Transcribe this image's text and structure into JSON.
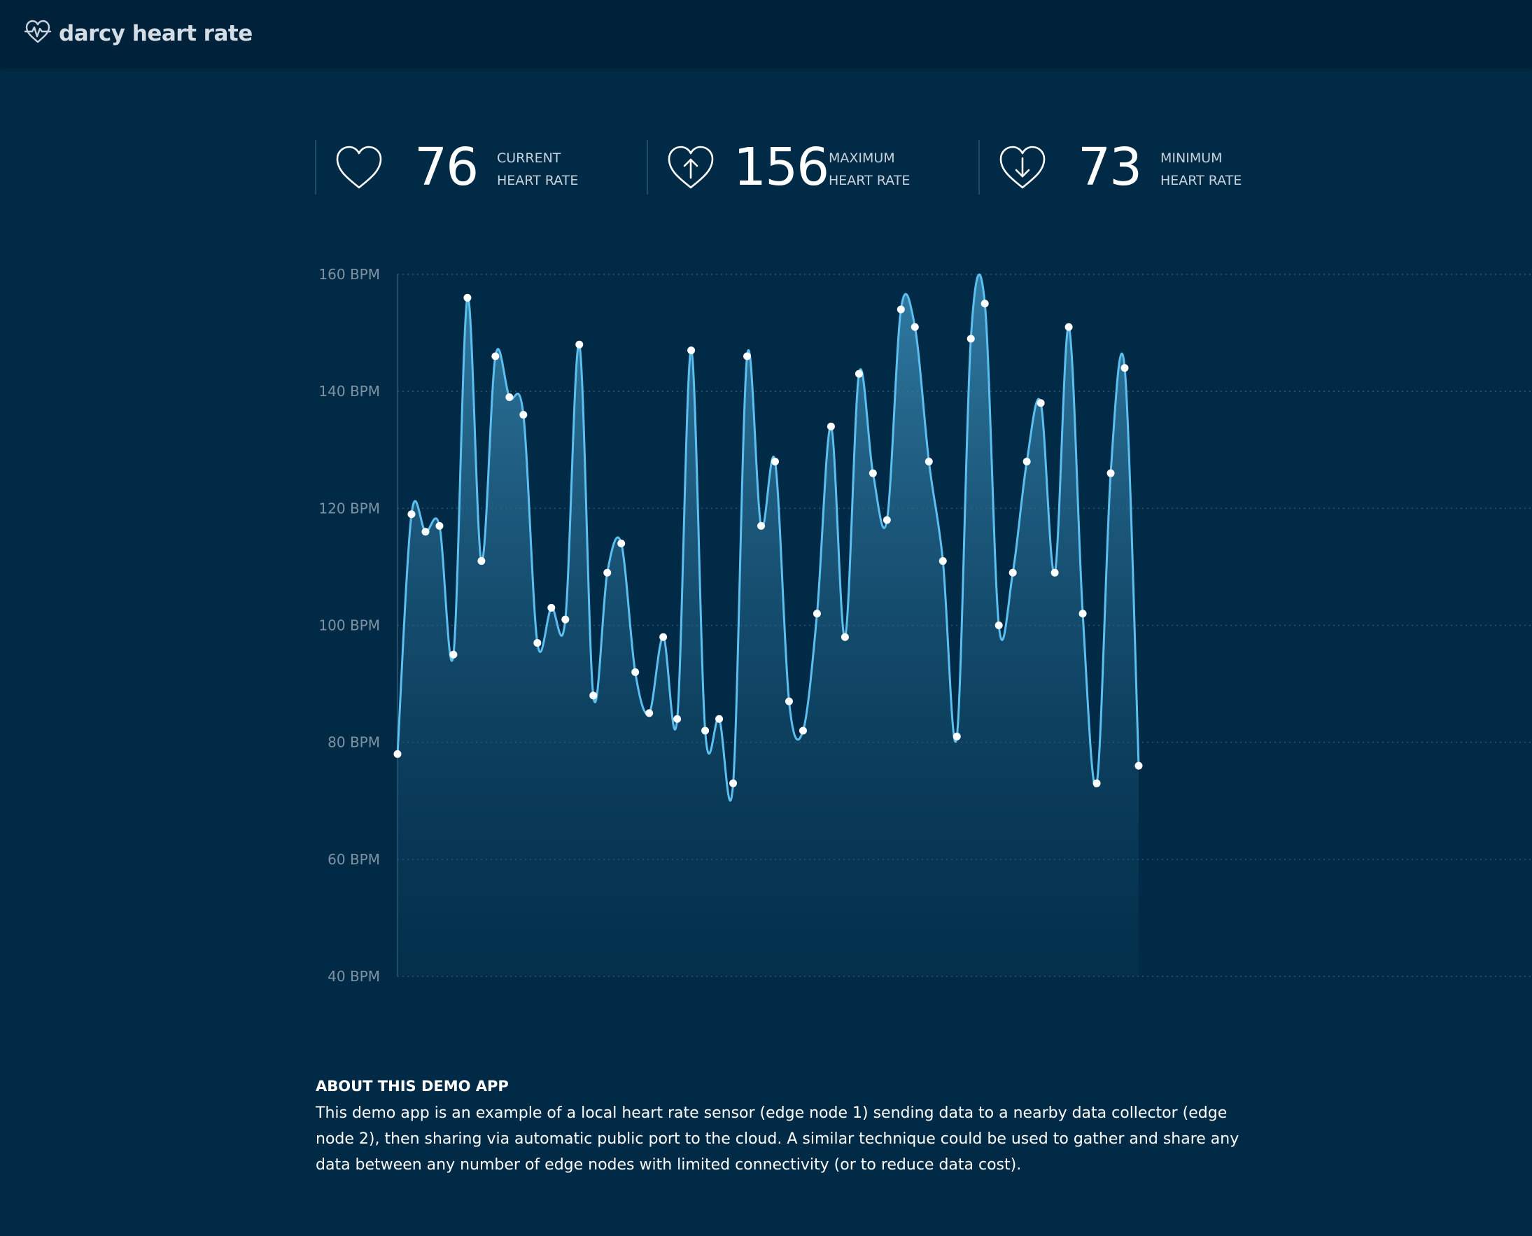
{
  "app": {
    "title": "darcy heart rate",
    "logo_icon": "heart-pulse-icon"
  },
  "stats": [
    {
      "id": "current",
      "icon": "heart-icon",
      "value": "76",
      "label_line1": "CURRENT",
      "label_line2": "HEART RATE"
    },
    {
      "id": "maximum",
      "icon": "heart-arrow-up-icon",
      "value": "156",
      "label_line1": "MAXIMUM",
      "label_line2": "HEART RATE"
    },
    {
      "id": "minimum",
      "icon": "heart-arrow-down-icon",
      "value": "73",
      "label_line1": "MINIMUM",
      "label_line2": "HEART RATE"
    }
  ],
  "chart_data": {
    "type": "area",
    "title": "",
    "xlabel": "",
    "ylabel": "",
    "ylim": [
      40,
      160
    ],
    "y_ticks": [
      40,
      60,
      80,
      100,
      120,
      140,
      160
    ],
    "y_tick_labels": [
      "40 BPM",
      "60 BPM",
      "80 BPM",
      "100 BPM",
      "120 BPM",
      "140 BPM",
      "160 BPM"
    ],
    "grid": true,
    "values": [
      78,
      119,
      116,
      117,
      95,
      156,
      111,
      146,
      139,
      136,
      97,
      103,
      101,
      148,
      88,
      109,
      114,
      92,
      85,
      98,
      84,
      147,
      82,
      84,
      73,
      146,
      117,
      128,
      87,
      82,
      102,
      134,
      98,
      143,
      126,
      118,
      154,
      151,
      128,
      111,
      81,
      149,
      155,
      100,
      109,
      128,
      138,
      109,
      151,
      102,
      73,
      126,
      144,
      76
    ],
    "colors": {
      "line": "#5bbff0",
      "point": "#ffffff",
      "grid": "#2d5670",
      "tick_text": "#7e93a3",
      "axis": "#2f5a74"
    }
  },
  "about": {
    "title": "ABOUT THIS DEMO APP",
    "body": "This demo app is an example of a local heart rate sensor (edge node 1) sending data to a nearby data collector (edge node 2), then sharing via automatic public port to the cloud. A similar technique could be used to gather and share any data between any number of edge nodes with limited connectivity (or to reduce data cost)."
  }
}
